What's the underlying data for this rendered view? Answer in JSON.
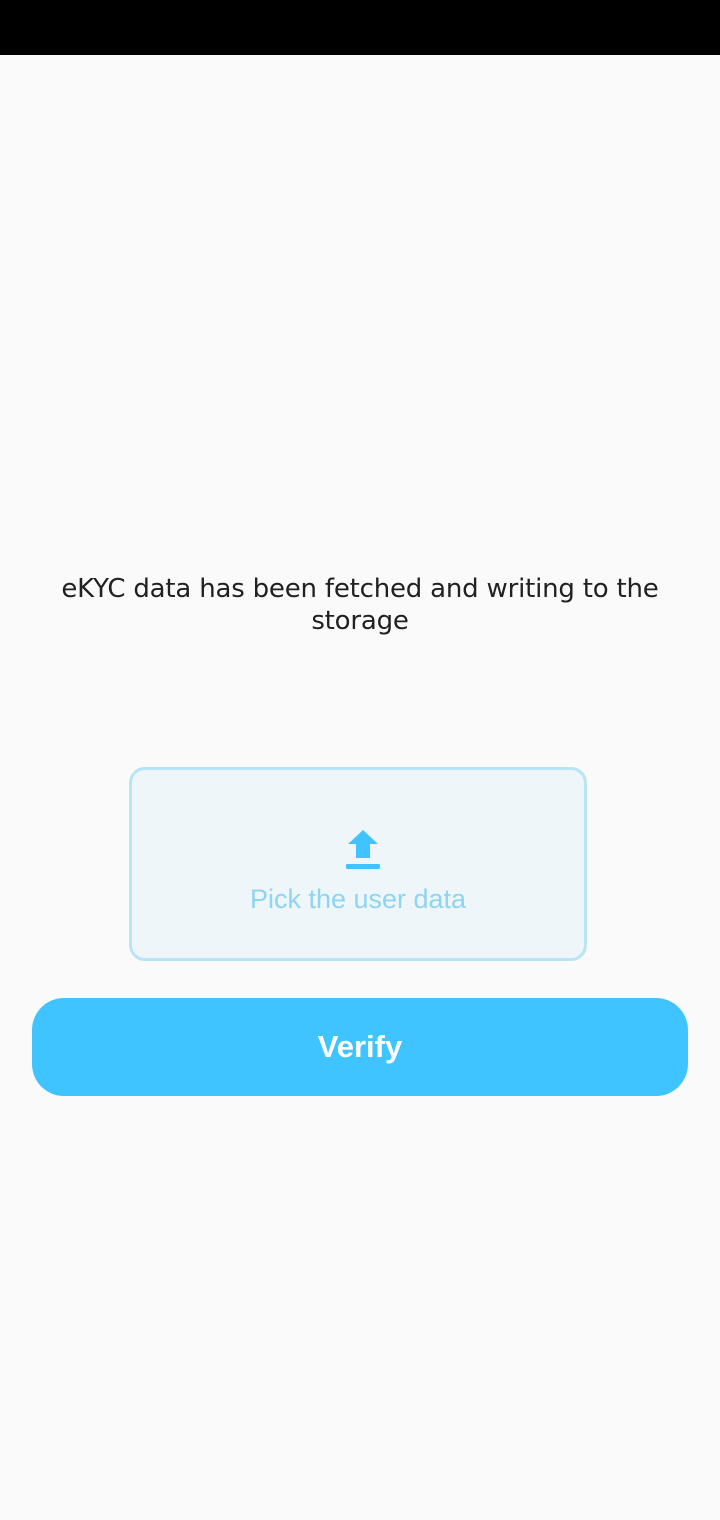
{
  "status_bar": {
    "color": "#000000"
  },
  "message": {
    "text": "eKYC data has been fetched and writing to the storage"
  },
  "picker": {
    "icon": "upload-icon",
    "label": "Pick the user data",
    "accent": "#40c4ff"
  },
  "verify": {
    "label": "Verify",
    "color": "#40c4ff"
  }
}
